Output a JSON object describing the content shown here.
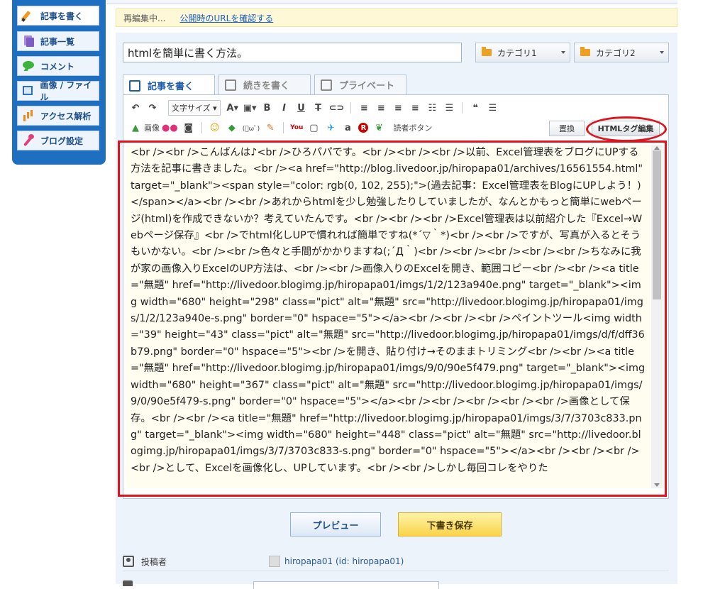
{
  "sidebar": {
    "items": [
      {
        "label": "記事を書く",
        "icon": "pencil-icon",
        "active": true
      },
      {
        "label": "記事一覧",
        "icon": "document-icon",
        "active": false
      },
      {
        "label": "コメント",
        "icon": "comment-bubble-icon",
        "active": false
      },
      {
        "label": "画像 / ファイル",
        "icon": "image-icon",
        "active": false
      },
      {
        "label": "アクセス解析",
        "icon": "bar-chart-icon",
        "active": false
      },
      {
        "label": "ブログ設定",
        "icon": "wrench-icon",
        "active": false
      }
    ]
  },
  "editbar": {
    "status": "再編集中...",
    "public_url_link": "公開時のURLを確認する"
  },
  "form": {
    "title_value": "htmlを簡単に書く方法。",
    "category1": "カテゴリ1",
    "category2": "カテゴリ2"
  },
  "tabs": [
    {
      "label": "記事を書く",
      "active": true
    },
    {
      "label": "続きを書く",
      "active": false
    },
    {
      "label": "プライベート",
      "active": false
    }
  ],
  "toolbar": {
    "font_size_label": "文字サイズ",
    "image_label": "画像",
    "reader_button_label": "読者ボタン",
    "replace_label": "置換",
    "html_tag_edit_label": "HTMLタグ編集"
  },
  "editor": {
    "content": "<br /><br />こんばんは♪<br />ひろパパです。<br /><br /><br />以前、Excel管理表をブログにUPする方法を記事に書きました。<br /><a  href=\"http://blog.livedoor.jp/hiropapa01/archives/16561554.html\" target=\"_blank\"><span  style=\"color: rgb(0, 102, 255);\">(過去記事：Excel管理表をBlogにUPしよう！)</span></a><br /><br />あれからhtmlを少し勉強したりしていましたが、なんとかもっと簡単にwebページ(html)を作成できないか？考えていたんです。<br /><br /><br />Excel管理表は以前紹介した『Excel→Webページ保存』<br />でhtml化しUPで慣れれば簡単ですね(*´▽｀*)<br /><br />ですが、写真が入るとそうもいかない。<br /><br />色々と手間がかかりますね(;´Д｀)<br /><br /><br /><br /><br />ちなみに我が家の画像入りExcelのUP方法は、<br /><br />画像入りのExcelを開き、範囲コピー<br /><br /><a  title=\"無題\" href=\"http://livedoor.blogimg.jp/hiropapa01/imgs/1/2/123a940e.png\" target=\"_blank\"><img  width=\"680\" height=\"298\" class=\"pict\" alt=\"無題\" src=\"http://livedoor.blogimg.jp/hiropapa01/imgs/1/2/123a940e-s.png\" border=\"0\" hspace=\"5\"></a><br /><br /><br />ペイントツール<img  width=\"39\" height=\"43\" class=\"pict\" alt=\"無題\" src=\"http://livedoor.blogimg.jp/hiropapa01/imgs/d/f/dff36b79.png\" border=\"0\" hspace=\"5\"><br />を開き、貼り付け→そのままトリミング<br /><br /><a  title=\"無題\" href=\"http://livedoor.blogimg.jp/hiropapa01/imgs/9/0/90e5f479.png\" target=\"_blank\"><img  width=\"680\" height=\"367\" class=\"pict\" alt=\"無題\" src=\"http://livedoor.blogimg.jp/hiropapa01/imgs/9/0/90e5f479-s.png\" border=\"0\" hspace=\"5\"></a><br /><br /><br /><br /><br />画像として保存。<br /><br /><a  title=\"無題\" href=\"http://livedoor.blogimg.jp/hiropapa01/imgs/3/7/3703c833.png\" target=\"_blank\"><img  width=\"680\" height=\"448\" class=\"pict\" alt=\"無題\" src=\"http://livedoor.blogimg.jp/hiropapa01/imgs/3/7/3703c833-s.png\" border=\"0\" hspace=\"5\"></a><br /><br /><br /><br />として、Excelを画像化し、UPしています。<br /><br />しかし毎回コレをやりた"
  },
  "actions": {
    "preview_label": "プレビュー",
    "draft_save_label": "下書き保存"
  },
  "poster": {
    "label": "投稿者",
    "value": "hiropapa01 (id: hiropapa01)"
  },
  "colors": {
    "sidebar_bg": "#1f6fc0",
    "highlight_red": "#e0141e",
    "draft_button": "#f9d44a"
  }
}
